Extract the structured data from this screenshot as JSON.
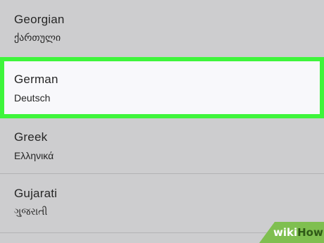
{
  "languages": [
    {
      "name": "Georgian",
      "native": "ქართული",
      "selected": false
    },
    {
      "name": "German",
      "native": "Deutsch",
      "selected": true
    },
    {
      "name": "Greek",
      "native": "Ελληνικά",
      "selected": false
    },
    {
      "name": "Gujarati",
      "native": "ગુજરાતી",
      "selected": false
    }
  ],
  "watermark": {
    "part1": "wiki",
    "part2": "How"
  },
  "colors": {
    "highlight_border": "#3ef53b",
    "selected_background": "#f8f8fb",
    "list_background": "#cdcdcf",
    "watermark_green": "#7fbf50"
  }
}
